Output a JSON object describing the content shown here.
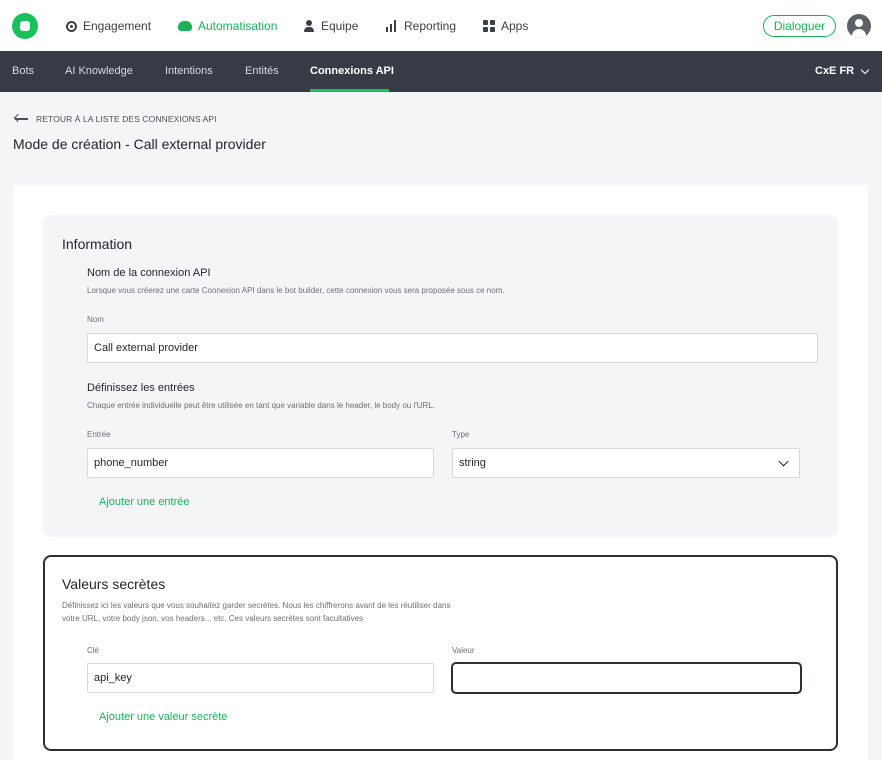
{
  "topnav": {
    "items": [
      {
        "label": "Engagement",
        "icon": "target-icon"
      },
      {
        "label": "Automatisation",
        "icon": "cloud-icon",
        "active": true
      },
      {
        "label": "Equipe",
        "icon": "user-icon"
      },
      {
        "label": "Reporting",
        "icon": "bar-chart-icon"
      },
      {
        "label": "Apps",
        "icon": "grid-icon"
      }
    ],
    "dialog_button": "Dialoguer",
    "accent_color": "#19b45a"
  },
  "subnav": {
    "items": [
      {
        "label": "Bots"
      },
      {
        "label": "AI Knowledge"
      },
      {
        "label": "Intentions"
      },
      {
        "label": "Entités"
      },
      {
        "label": "Connexions API",
        "active": true
      }
    ],
    "language": "CxE FR"
  },
  "breadcrumb": {
    "back_label": "RETOUR À LA LISTE DES CONNEXIONS API"
  },
  "page_title": "Mode de création - Call external provider",
  "information": {
    "title": "Information",
    "name_section": {
      "title": "Nom de la connexion API",
      "description": "Lorsque vous créerez une carte Connexion API dans le bot builder, cette connexion vous sera proposée sous ce nom.",
      "field_label": "Nom",
      "value": "Call external provider"
    },
    "inputs_section": {
      "title": "Définissez les entrées",
      "description": "Chaque entrée individuelle peut être utilisée en tant que variable dans le header, le body ou l'URL.",
      "entry_label": "Entrée",
      "entry_value": "phone_number",
      "type_label": "Type",
      "type_value": "string",
      "add_link": "Ajouter une entrée"
    }
  },
  "secrets": {
    "title": "Valeurs secrètes",
    "description_line1": "Définissez ici les valeurs que vous souhaitez garder secrètes. Nous les chiffrerons avant de les réutiliser dans",
    "description_line2": "votre URL, votre body json, vos headers... etc. Ces valeurs secrètes sont facultatives",
    "key_label": "Clé",
    "key_value": "api_key",
    "value_label": "Valeur",
    "value_value": "",
    "add_link": "Ajouter une valeur secrète"
  }
}
